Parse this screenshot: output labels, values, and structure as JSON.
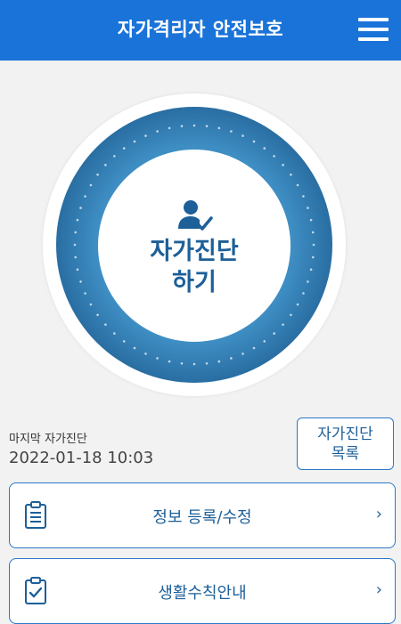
{
  "header": {
    "title": "자가격리자 안전보호",
    "menu_icon": "hamburger-menu-icon",
    "background": "#1a73d8"
  },
  "hero": {
    "button_label": "자가진단\n하기",
    "icon": "person-check-icon",
    "accent": "#1d5f98"
  },
  "last_diagnosis": {
    "label": "마지막 자가진단",
    "datetime": "2022-01-18 10:03",
    "list_button_label": "자가진단\n목록"
  },
  "menu": [
    {
      "label": "정보 등록/수정",
      "icon": "clipboard-list-icon",
      "chevron": "›"
    },
    {
      "label": "생활수칙안내",
      "icon": "clipboard-check-icon",
      "chevron": "›"
    }
  ]
}
